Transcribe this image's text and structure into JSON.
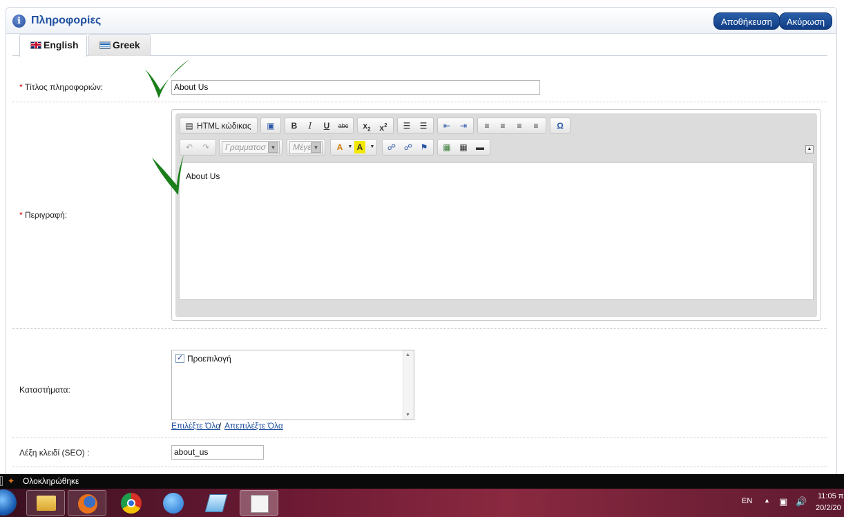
{
  "header": {
    "title": "Πληροφορίες",
    "save_label": "Αποθήκευση",
    "cancel_label": "Ακύρωση"
  },
  "tabs": [
    {
      "label": "English",
      "flag": "uk-flag-icon"
    },
    {
      "label": "Greek",
      "flag": "greek-flag-icon"
    }
  ],
  "form": {
    "title_label": "Τίτλος πληροφοριών:",
    "title_value": "About Us",
    "description_label": "Περιγραφή:",
    "description_content": "About Us",
    "stores_label": "Καταστήματα:",
    "stores": [
      {
        "label": "Προεπιλογή",
        "checked": true
      }
    ],
    "select_all": "Επιλέξτε Όλα",
    "separator": "/",
    "deselect_all": "Απεπιλέξτε Όλα",
    "seo_label": "Λέξη κλειδί (SEO) :",
    "seo_value": "about_us"
  },
  "editor_toolbar": {
    "html_source_label": "HTML κώδικας",
    "font_combo": "Γραμματοσ",
    "size_combo": "Μέγε"
  },
  "status_bar": {
    "text": "Ολοκληρώθηκε"
  },
  "system_tray": {
    "language": "EN",
    "time": "11:05 π",
    "date": "20/2/20"
  },
  "colors": {
    "accent": "#1f4fa0",
    "check_mark": "#1a7f1a",
    "required": "#cc0000"
  }
}
